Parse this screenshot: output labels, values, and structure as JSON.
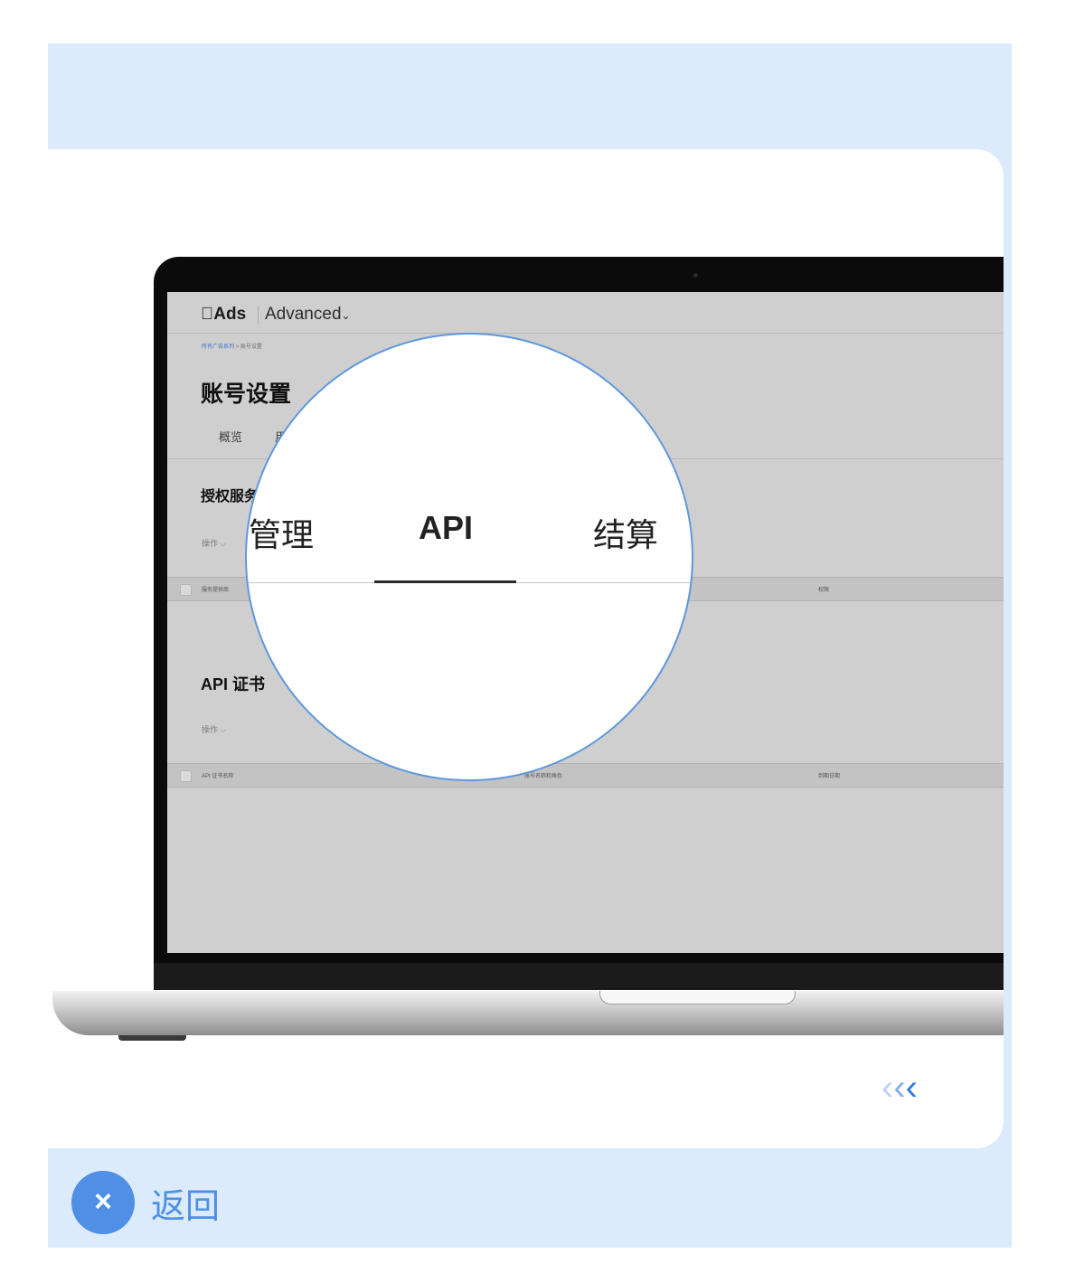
{
  "screen": {
    "logo_text": "Ads",
    "product_switcher": "Advanced",
    "breadcrumb": {
      "parent": "所有广告系列",
      "separator": ">",
      "current": "账号设置"
    },
    "page_title": "账号设置",
    "tabs": [
      "概览",
      "用"
    ],
    "section_auth": {
      "title": "授权服务",
      "ops": "操作 ⌵",
      "col1": "服务提供商",
      "col2": "权限"
    },
    "section_api": {
      "title": "API 证书",
      "ops": "操作 ⌵",
      "col1": "API 证书名称",
      "col2": "账号名称和角色",
      "col3": "到期日期"
    }
  },
  "magnifier": {
    "tabs": [
      {
        "label": "管理",
        "active": false
      },
      {
        "label": "API",
        "active": true
      },
      {
        "label": "结算",
        "active": false
      }
    ]
  },
  "swipe_hint": {
    "glyph": "‹",
    "colors": [
      "#b9d3f6",
      "#7fb0ee",
      "#2f7be0"
    ]
  },
  "footer": {
    "close_icon": "×",
    "back_label": "返回"
  },
  "colors": {
    "accent": "#4f8fe6",
    "panel_bg": "#dcebfb",
    "magnifier_border": "#5f97dd"
  }
}
